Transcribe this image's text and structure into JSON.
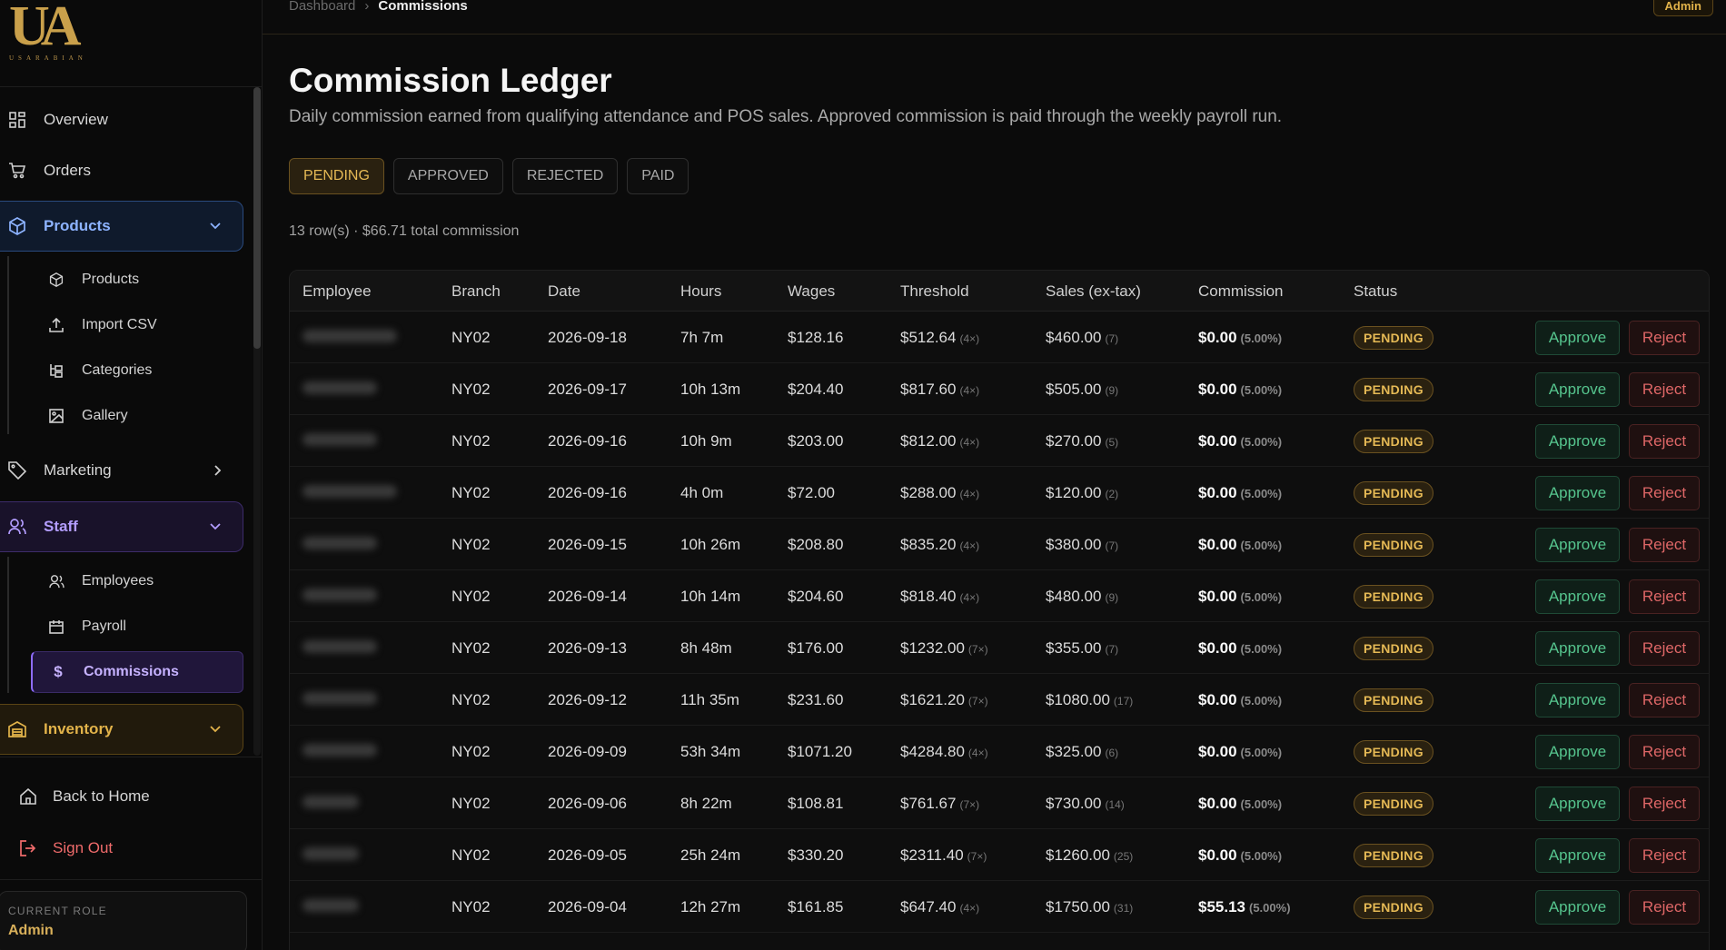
{
  "brand": {
    "logo_text": "UA",
    "wordmark": "USARABIAN"
  },
  "sidebar": {
    "overview": "Overview",
    "orders": "Orders",
    "products_group": "Products",
    "products_sub": [
      "Products",
      "Import CSV",
      "Categories",
      "Gallery"
    ],
    "marketing": "Marketing",
    "staff_group": "Staff",
    "staff_sub": [
      "Employees",
      "Payroll",
      "Commissions"
    ],
    "inventory": "Inventory",
    "back_home": "Back to Home",
    "sign_out": "Sign Out",
    "role_caption": "CURRENT ROLE",
    "role_value": "Admin"
  },
  "header": {
    "breadcrumb_root": "Dashboard",
    "breadcrumb_sep": "›",
    "breadcrumb_current": "Commissions",
    "admin_chip": "Admin"
  },
  "page": {
    "title": "Commission Ledger",
    "description": "Daily commission earned from qualifying attendance and POS sales. Approved commission is paid through the weekly payroll run.",
    "tabs": [
      "PENDING",
      "APPROVED",
      "REJECTED",
      "PAID"
    ],
    "active_tab": "PENDING",
    "summary": "13 row(s) · $66.71 total commission"
  },
  "table": {
    "columns": [
      "Employee",
      "Branch",
      "Date",
      "Hours",
      "Wages",
      "Threshold",
      "Sales (ex-tax)",
      "Commission",
      "Status"
    ],
    "approve_label": "Approve",
    "reject_label": "Reject",
    "rows": [
      {
        "branch": "NY02",
        "date": "2026-09-18",
        "hours": "7h 7m",
        "wages": "$128.16",
        "threshold": "$512.64",
        "mult": "(4×)",
        "sales": "$460.00",
        "sales_n": "(7)",
        "commission": "$0.00",
        "rate": "(5.00%)",
        "status": "PENDING"
      },
      {
        "branch": "NY02",
        "date": "2026-09-17",
        "hours": "10h 13m",
        "wages": "$204.40",
        "threshold": "$817.60",
        "mult": "(4×)",
        "sales": "$505.00",
        "sales_n": "(9)",
        "commission": "$0.00",
        "rate": "(5.00%)",
        "status": "PENDING"
      },
      {
        "branch": "NY02",
        "date": "2026-09-16",
        "hours": "10h 9m",
        "wages": "$203.00",
        "threshold": "$812.00",
        "mult": "(4×)",
        "sales": "$270.00",
        "sales_n": "(5)",
        "commission": "$0.00",
        "rate": "(5.00%)",
        "status": "PENDING"
      },
      {
        "branch": "NY02",
        "date": "2026-09-16",
        "hours": "4h 0m",
        "wages": "$72.00",
        "threshold": "$288.00",
        "mult": "(4×)",
        "sales": "$120.00",
        "sales_n": "(2)",
        "commission": "$0.00",
        "rate": "(5.00%)",
        "status": "PENDING"
      },
      {
        "branch": "NY02",
        "date": "2026-09-15",
        "hours": "10h 26m",
        "wages": "$208.80",
        "threshold": "$835.20",
        "mult": "(4×)",
        "sales": "$380.00",
        "sales_n": "(7)",
        "commission": "$0.00",
        "rate": "(5.00%)",
        "status": "PENDING"
      },
      {
        "branch": "NY02",
        "date": "2026-09-14",
        "hours": "10h 14m",
        "wages": "$204.60",
        "threshold": "$818.40",
        "mult": "(4×)",
        "sales": "$480.00",
        "sales_n": "(9)",
        "commission": "$0.00",
        "rate": "(5.00%)",
        "status": "PENDING"
      },
      {
        "branch": "NY02",
        "date": "2026-09-13",
        "hours": "8h 48m",
        "wages": "$176.00",
        "threshold": "$1232.00",
        "mult": "(7×)",
        "sales": "$355.00",
        "sales_n": "(7)",
        "commission": "$0.00",
        "rate": "(5.00%)",
        "status": "PENDING"
      },
      {
        "branch": "NY02",
        "date": "2026-09-12",
        "hours": "11h 35m",
        "wages": "$231.60",
        "threshold": "$1621.20",
        "mult": "(7×)",
        "sales": "$1080.00",
        "sales_n": "(17)",
        "commission": "$0.00",
        "rate": "(5.00%)",
        "status": "PENDING"
      },
      {
        "branch": "NY02",
        "date": "2026-09-09",
        "hours": "53h 34m",
        "wages": "$1071.20",
        "threshold": "$4284.80",
        "mult": "(4×)",
        "sales": "$325.00",
        "sales_n": "(6)",
        "commission": "$0.00",
        "rate": "(5.00%)",
        "status": "PENDING"
      },
      {
        "branch": "NY02",
        "date": "2026-09-06",
        "hours": "8h 22m",
        "wages": "$108.81",
        "threshold": "$761.67",
        "mult": "(7×)",
        "sales": "$730.00",
        "sales_n": "(14)",
        "commission": "$0.00",
        "rate": "(5.00%)",
        "status": "PENDING"
      },
      {
        "branch": "NY02",
        "date": "2026-09-05",
        "hours": "25h 24m",
        "wages": "$330.20",
        "threshold": "$2311.40",
        "mult": "(7×)",
        "sales": "$1260.00",
        "sales_n": "(25)",
        "commission": "$0.00",
        "rate": "(5.00%)",
        "status": "PENDING"
      },
      {
        "branch": "NY02",
        "date": "2026-09-04",
        "hours": "12h 27m",
        "wages": "$161.85",
        "threshold": "$647.40",
        "mult": "(4×)",
        "sales": "$1750.00",
        "sales_n": "(31)",
        "commission": "$55.13",
        "rate": "(5.00%)",
        "status": "PENDING"
      }
    ]
  }
}
